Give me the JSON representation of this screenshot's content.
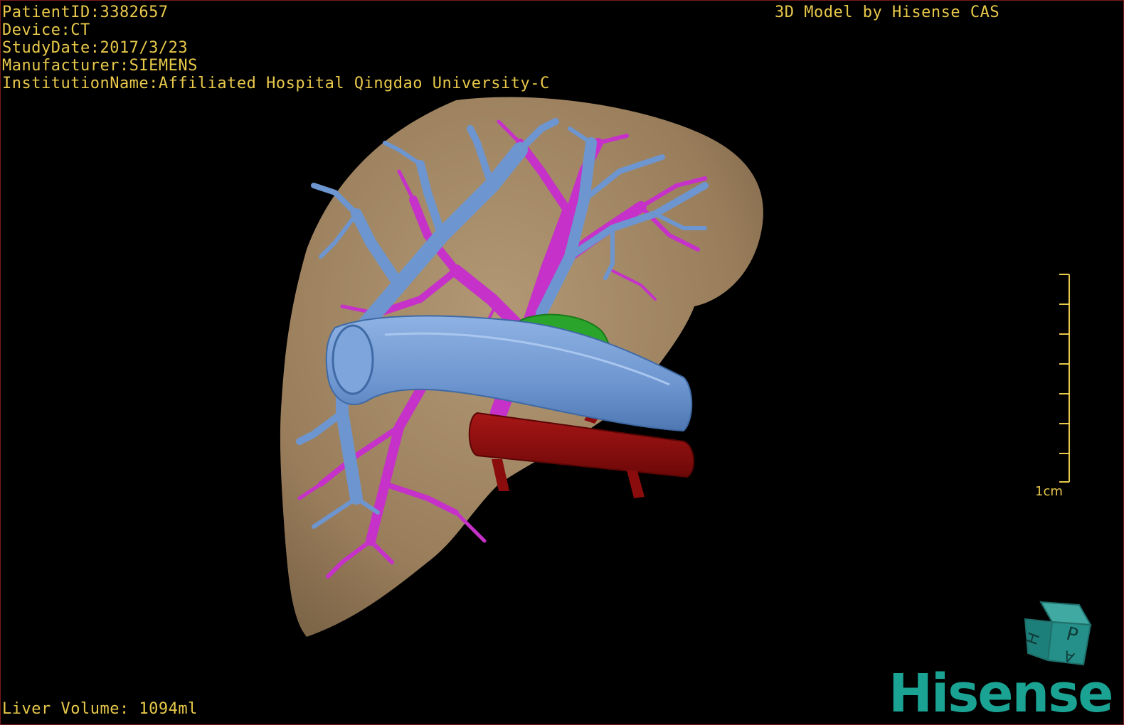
{
  "viewer": {
    "patient_id": "PatientID:3382657",
    "device": "Device:CT",
    "study_date": "StudyDate:2017/3/23",
    "manufacturer": "Manufacturer:SIEMENS",
    "institution": "InstitutionName:Affiliated Hospital Qingdao University-C",
    "header_title": "3D Model by Hisense CAS",
    "liver_volume": "Liver Volume: 1094ml",
    "scale_label": "1cm",
    "brand_name": "Hisense"
  },
  "orientation_cube": {
    "labels": [
      "P",
      "H",
      "A"
    ]
  },
  "colors": {
    "overlay_text": "#e8c94a",
    "liver": "#a08462",
    "hepatic_vein": "#6d95cf",
    "portal_vein": "#c531c9",
    "ivc_artery": "#8a0c0c",
    "lesion": "#2aa42a",
    "brand": "#1aa393"
  }
}
